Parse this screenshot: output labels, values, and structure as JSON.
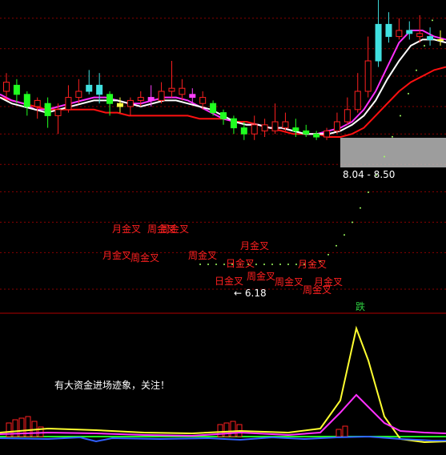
{
  "chart_data": {
    "type": "candlestick",
    "price_panel": {
      "ylim": [
        0,
        100
      ],
      "gridlines": [
        5,
        17,
        27,
        37,
        46,
        56,
        65,
        75,
        84,
        94
      ],
      "candles": [
        {
          "o": 70,
          "c": 73,
          "h": 76,
          "l": 68,
          "color": "red"
        },
        {
          "o": 72,
          "c": 69,
          "h": 74,
          "l": 66,
          "color": "green"
        },
        {
          "o": 69,
          "c": 65,
          "h": 70,
          "l": 62,
          "color": "green"
        },
        {
          "o": 65,
          "c": 67,
          "h": 68,
          "l": 61,
          "color": "red"
        },
        {
          "o": 66,
          "c": 62,
          "h": 68,
          "l": 58,
          "color": "green"
        },
        {
          "o": 62,
          "c": 64,
          "h": 66,
          "l": 56,
          "color": "red"
        },
        {
          "o": 64,
          "c": 68,
          "h": 72,
          "l": 63,
          "color": "red"
        },
        {
          "o": 68,
          "c": 70,
          "h": 74,
          "l": 66,
          "color": "red"
        },
        {
          "o": 70,
          "c": 72,
          "h": 77,
          "l": 69,
          "color": "cyan"
        },
        {
          "o": 72,
          "c": 69,
          "h": 76,
          "l": 66,
          "color": "cyan"
        },
        {
          "o": 69,
          "c": 66,
          "h": 70,
          "l": 62,
          "color": "green"
        },
        {
          "o": 66,
          "c": 65,
          "h": 68,
          "l": 63,
          "color": "yellow"
        },
        {
          "o": 65,
          "c": 67,
          "h": 68,
          "l": 62,
          "color": "red"
        },
        {
          "o": 67,
          "c": 68,
          "h": 70,
          "l": 65,
          "color": "red"
        },
        {
          "o": 68,
          "c": 67,
          "h": 72,
          "l": 65,
          "color": "magenta"
        },
        {
          "o": 67,
          "c": 70,
          "h": 73,
          "l": 66,
          "color": "red"
        },
        {
          "o": 70,
          "c": 71,
          "h": 80,
          "l": 68,
          "color": "red"
        },
        {
          "o": 71,
          "c": 69,
          "h": 74,
          "l": 67,
          "color": "red"
        },
        {
          "o": 69,
          "c": 68,
          "h": 71,
          "l": 66,
          "color": "magenta"
        },
        {
          "o": 68,
          "c": 66,
          "h": 70,
          "l": 64,
          "color": "red"
        },
        {
          "o": 66,
          "c": 63,
          "h": 67,
          "l": 62,
          "color": "green"
        },
        {
          "o": 63,
          "c": 61,
          "h": 64,
          "l": 59,
          "color": "green"
        },
        {
          "o": 61,
          "c": 58,
          "h": 62,
          "l": 56,
          "color": "green"
        },
        {
          "o": 58,
          "c": 56,
          "h": 60,
          "l": 54,
          "color": "green"
        },
        {
          "o": 56,
          "c": 59,
          "h": 62,
          "l": 54,
          "color": "red"
        },
        {
          "o": 59,
          "c": 57,
          "h": 61,
          "l": 55,
          "color": "red"
        },
        {
          "o": 57,
          "c": 60,
          "h": 66,
          "l": 56,
          "color": "red"
        },
        {
          "o": 60,
          "c": 58,
          "h": 63,
          "l": 57,
          "color": "red"
        },
        {
          "o": 58,
          "c": 57,
          "h": 61,
          "l": 55,
          "color": "green"
        },
        {
          "o": 57,
          "c": 56,
          "h": 59,
          "l": 55,
          "color": "green"
        },
        {
          "o": 56,
          "c": 55,
          "h": 57,
          "l": 54,
          "color": "green"
        },
        {
          "o": 55,
          "c": 57,
          "h": 58,
          "l": 54,
          "color": "red"
        },
        {
          "o": 57,
          "c": 60,
          "h": 63,
          "l": 56,
          "color": "red"
        },
        {
          "o": 60,
          "c": 64,
          "h": 68,
          "l": 59,
          "color": "red"
        },
        {
          "o": 64,
          "c": 70,
          "h": 76,
          "l": 63,
          "color": "red"
        },
        {
          "o": 70,
          "c": 80,
          "h": 88,
          "l": 68,
          "color": "red"
        },
        {
          "o": 80,
          "c": 92,
          "h": 100,
          "l": 78,
          "color": "cyan"
        },
        {
          "o": 92,
          "c": 88,
          "h": 96,
          "l": 86,
          "color": "cyan"
        },
        {
          "o": 88,
          "c": 90,
          "h": 94,
          "l": 87,
          "color": "red"
        },
        {
          "o": 90,
          "c": 89,
          "h": 93,
          "l": 87,
          "color": "cyan"
        },
        {
          "o": 89,
          "c": 88,
          "h": 95,
          "l": 86,
          "color": "red"
        },
        {
          "o": 88,
          "c": 87,
          "h": 91,
          "l": 85,
          "color": "cyan"
        },
        {
          "o": 87,
          "c": 87,
          "h": 90,
          "l": 85,
          "color": "yellow"
        }
      ],
      "ma_red": [
        68,
        67,
        66,
        65,
        64,
        64,
        64,
        64,
        64,
        63,
        63,
        62,
        62,
        62,
        62,
        62,
        62,
        61,
        61,
        61,
        60,
        60,
        59,
        58,
        57,
        56,
        56,
        56,
        55,
        55,
        56,
        58,
        62,
        66,
        70,
        73,
        75,
        77,
        78
      ],
      "ma_white": [
        68,
        66,
        65,
        64,
        63,
        64,
        65,
        66,
        67,
        67,
        67,
        66,
        65,
        66,
        67,
        67,
        66,
        65,
        64,
        62,
        60,
        59,
        59,
        58,
        58,
        57,
        56,
        56,
        56,
        57,
        59,
        62,
        67,
        74,
        80,
        85,
        87,
        87,
        86
      ],
      "ma_magenta": [
        69,
        67,
        66,
        64,
        64,
        65,
        66,
        67,
        68,
        68,
        67,
        66,
        66,
        67,
        68,
        68,
        67,
        65,
        63,
        61,
        60,
        59,
        59,
        58,
        58,
        57,
        56,
        56,
        57,
        58,
        60,
        64,
        70,
        78,
        86,
        90,
        90,
        88,
        87
      ],
      "annotations": [
        {
          "text": "月金叉",
          "color": "#ff2020"
        },
        {
          "text": "周金叉",
          "color": "#ff2020"
        },
        {
          "text": "周金叉",
          "color": "#ff2020"
        },
        {
          "text": "月金叉",
          "color": "#ff2020"
        },
        {
          "text": "周金叉",
          "color": "#ff2020"
        },
        {
          "text": "周金叉",
          "color": "#ff2020"
        },
        {
          "text": "月金叉",
          "color": "#ff2020"
        },
        {
          "text": "日金叉",
          "color": "#ff2020"
        },
        {
          "text": "周金叉",
          "color": "#ff2020"
        },
        {
          "text": "日金叉",
          "color": "#ff2020"
        },
        {
          "text": "周金叉",
          "color": "#ff2020"
        },
        {
          "text": "月金叉",
          "color": "#ff2020"
        },
        {
          "text": "周金叉",
          "color": "#ff2020"
        },
        {
          "text": "月金叉",
          "color": "#ff2020"
        }
      ],
      "low_marker": "← 6.18",
      "range_box": "8.04 - 8.50"
    },
    "indicator_panel": {
      "top_badge": "跌",
      "note": "有大资金进场迹象，关注！",
      "yellow_peak": 100,
      "magenta_peak": 50
    }
  }
}
